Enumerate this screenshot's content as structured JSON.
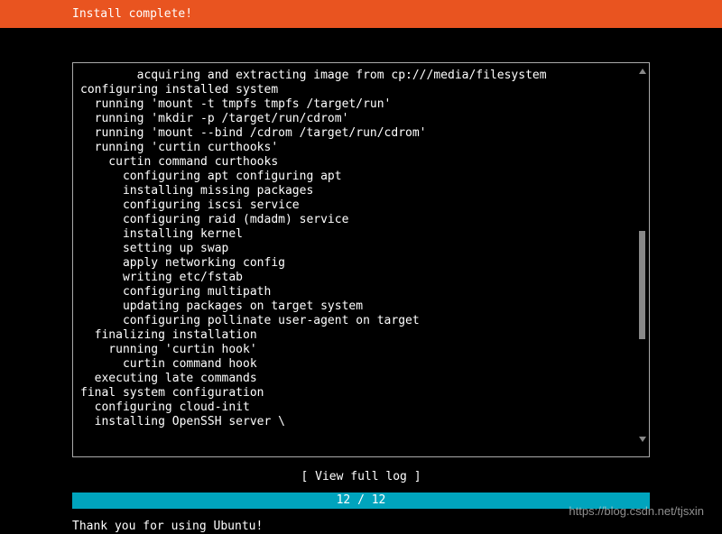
{
  "header": {
    "title": "Install complete!"
  },
  "log": {
    "lines": [
      "        acquiring and extracting image from cp:///media/filesystem",
      "configuring installed system",
      "  running 'mount -t tmpfs tmpfs /target/run'",
      "  running 'mkdir -p /target/run/cdrom'",
      "  running 'mount --bind /cdrom /target/run/cdrom'",
      "  running 'curtin curthooks'",
      "    curtin command curthooks",
      "      configuring apt configuring apt",
      "      installing missing packages",
      "      configuring iscsi service",
      "      configuring raid (mdadm) service",
      "      installing kernel",
      "      setting up swap",
      "      apply networking config",
      "      writing etc/fstab",
      "      configuring multipath",
      "      updating packages on target system",
      "      configuring pollinate user-agent on target",
      "  finalizing installation",
      "    running 'curtin hook'",
      "      curtin command hook",
      "  executing late commands",
      "final system configuration",
      "  configuring cloud-init",
      "  installing OpenSSH server \\"
    ]
  },
  "actions": {
    "view_log_label": "[ View full log ]"
  },
  "progress": {
    "text": "12 / 12"
  },
  "footer": {
    "message": "Thank you for using Ubuntu!"
  },
  "watermark": {
    "text": "https://blog.csdn.net/tjsxin"
  }
}
